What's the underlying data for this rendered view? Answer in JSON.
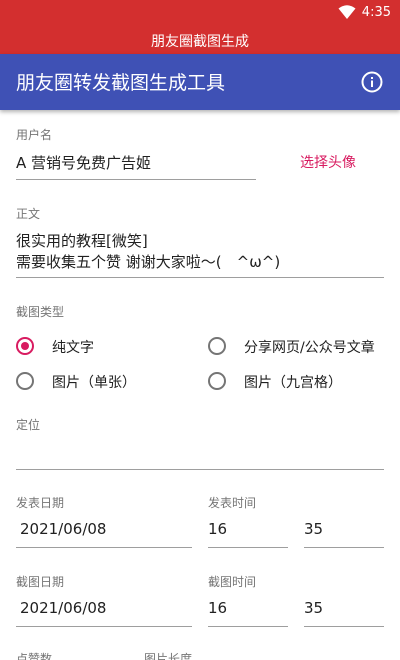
{
  "status_bar": {
    "time": "4:35",
    "title": "朋友圈截图生成"
  },
  "app_bar": {
    "title": "朋友圈转发截图生成工具"
  },
  "form": {
    "username_label": "用户名",
    "username_value": "A 营销号免费广告姬",
    "choose_avatar": "选择头像",
    "body_label": "正文",
    "body_line1": "很实用的教程[微笑]",
    "body_line2": "需要收集五个赞 谢谢大家啦～(　^ω^)",
    "type_label": "截图类型",
    "types": [
      "纯文字",
      "分享网页/公众号文章",
      "图片（单张）",
      "图片（九宫格）"
    ],
    "location_label": "定位",
    "publish_date_label": "发表日期",
    "publish_date": "2021/06/08",
    "publish_time_label": "发表时间",
    "publish_hour": "16",
    "publish_minute": "35",
    "shot_date_label": "截图日期",
    "shot_date": "2021/06/08",
    "shot_time_label": "截图时间",
    "shot_hour": "16",
    "shot_minute": "35",
    "likes_label": "点赞数",
    "image_length_label": "图片长度"
  }
}
